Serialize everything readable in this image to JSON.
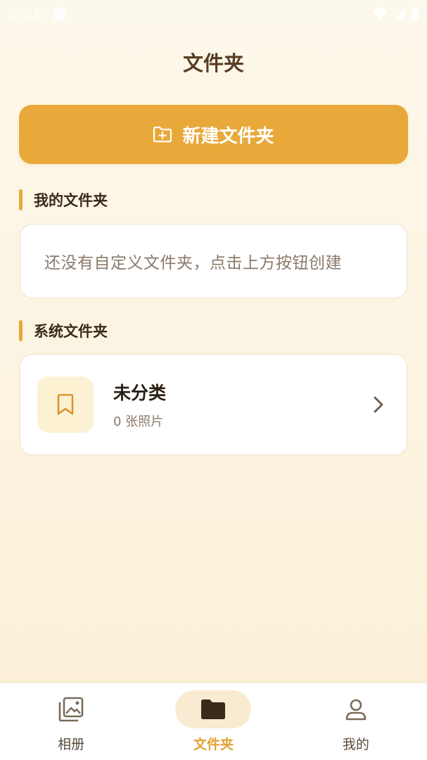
{
  "status_bar": {
    "time": "5:58"
  },
  "header": {
    "title": "文件夹"
  },
  "new_folder_button": {
    "label": "新建文件夹",
    "icon": "folder-plus-icon"
  },
  "my_folders": {
    "heading": "我的文件夹",
    "empty_message": "还没有自定义文件夹，点击上方按钮创建"
  },
  "system_folders": {
    "heading": "系统文件夹",
    "items": [
      {
        "name": "未分类",
        "count_text": "0 张照片",
        "icon": "bookmark-icon"
      }
    ]
  },
  "bottom_nav": {
    "items": [
      {
        "label": "相册",
        "icon": "album-icon",
        "active": false
      },
      {
        "label": "文件夹",
        "icon": "folder-icon",
        "active": true
      },
      {
        "label": "我的",
        "icon": "user-icon",
        "active": false
      }
    ]
  },
  "colors": {
    "accent": "#e8a93a",
    "title": "#5a3d22",
    "background": "#fdf8ec"
  }
}
